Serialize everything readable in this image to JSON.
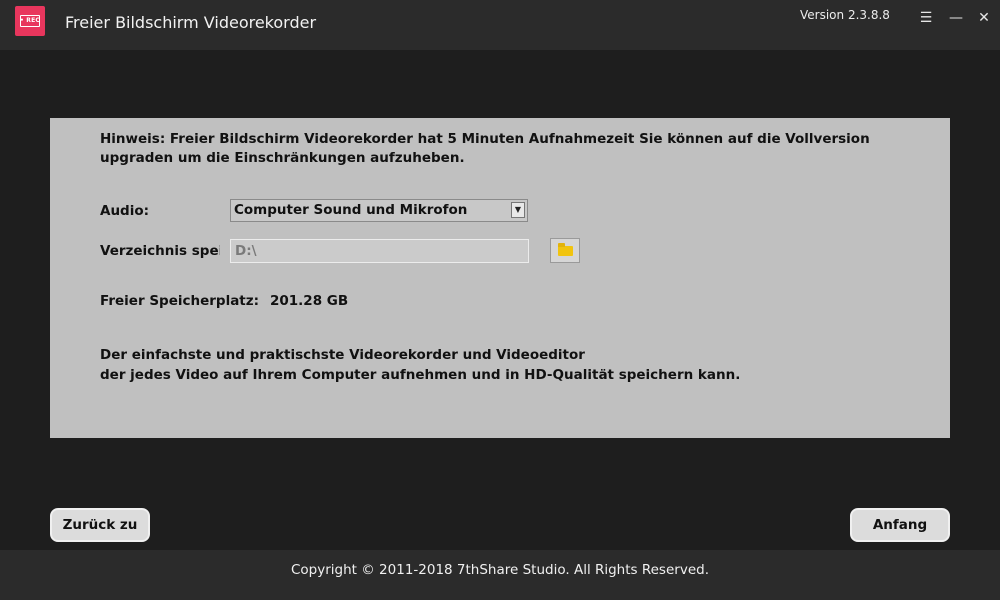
{
  "titlebar": {
    "logo_text": "• REC",
    "title": "Freier Bildschirm Videorekorder",
    "version": "Version 2.3.8.8",
    "menu_glyph": "☰",
    "minimize_glyph": "—",
    "close_glyph": "✕"
  },
  "panel": {
    "hint": "Hinweis: Freier Bildschirm Videorekorder hat 5 Minuten Aufnahmezeit Sie können auf die Vollversion upgraden um die Einschränkungen aufzuheben.",
    "audio_label": "Audio:",
    "audio_selected": "Computer Sound und Mikrofon",
    "dir_label": "Verzeichnis speichern:",
    "dir_value": "D:\\",
    "free_label": "Freier Speicherplatz:",
    "free_value": "201.28 GB",
    "desc_line1": "Der einfachste und praktischste Videorekorder und Videoeditor",
    "desc_line2": "der jedes Video auf Ihrem Computer aufnehmen und in HD-Qualität speichern kann."
  },
  "buttons": {
    "back": "Zurück zu",
    "start": "Anfang"
  },
  "footer": {
    "copyright": "Copyright © 2011-2018 7thShare Studio. All Rights Reserved."
  },
  "icons": {
    "logo": "rec-logo-icon",
    "menu": "menu-icon",
    "minimize": "minimize-icon",
    "close": "close-icon",
    "dropdown": "chevron-down-icon",
    "folder": "folder-icon"
  },
  "colors": {
    "accent_logo": "#e8365d",
    "folder": "#f1c40f",
    "panel": "#c0c0c0",
    "background": "#1e1e1e"
  }
}
